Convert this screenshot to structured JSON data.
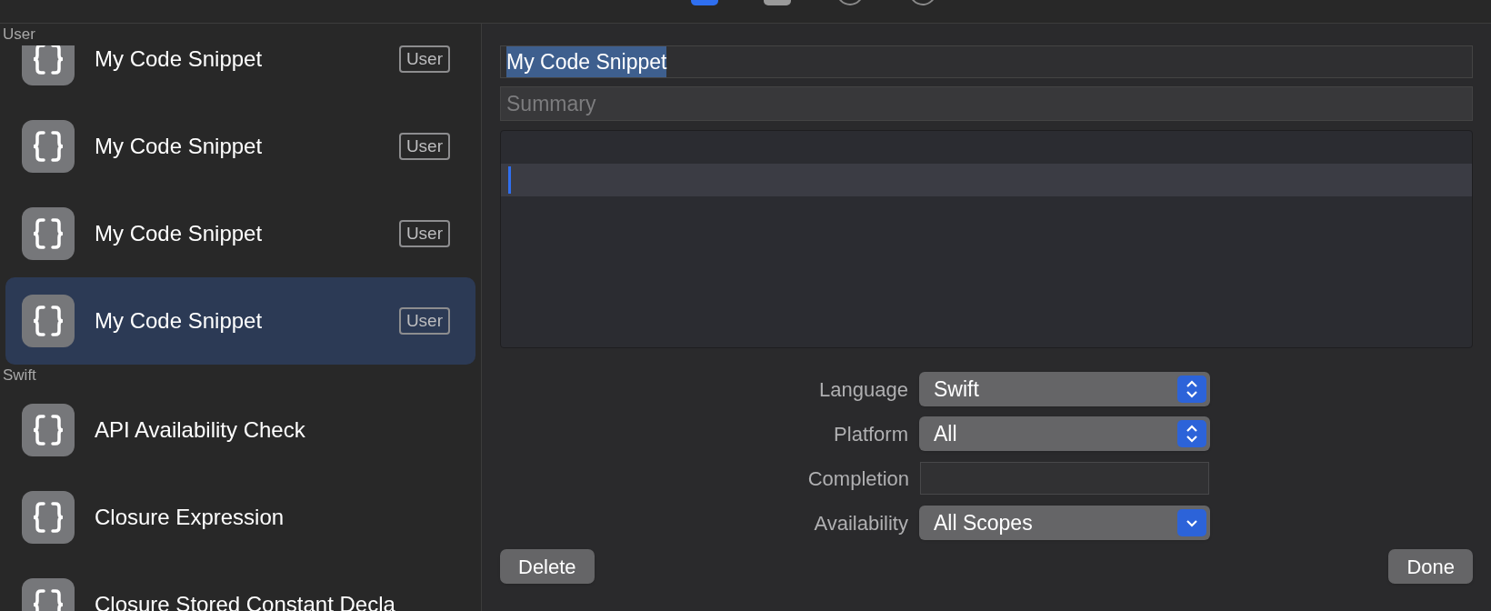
{
  "toolbar": {
    "tabs": [
      {
        "selected": true
      },
      {
        "selected": false
      },
      {
        "selected": false
      },
      {
        "selected": false
      }
    ]
  },
  "sidebar": {
    "sections": [
      {
        "title": "User",
        "items": [
          {
            "title": "My Code Snippet",
            "badge": "User",
            "selected": false
          },
          {
            "title": "My Code Snippet",
            "badge": "User",
            "selected": false
          },
          {
            "title": "My Code Snippet",
            "badge": "User",
            "selected": false
          },
          {
            "title": "My Code Snippet",
            "badge": "User",
            "selected": true
          }
        ]
      },
      {
        "title": "Swift",
        "items": [
          {
            "title": "API Availability Check",
            "selected": false
          },
          {
            "title": "Closure Expression",
            "selected": false
          },
          {
            "title": "Closure Stored Constant Decla",
            "selected": false
          }
        ]
      }
    ]
  },
  "editor": {
    "title": {
      "value": "My Code Snippet",
      "text_selected": true
    },
    "summary": {
      "placeholder": "Summary"
    },
    "code": {
      "current_line_highlighted": true
    },
    "fields": [
      {
        "label": "Language",
        "kind": "stepper",
        "value": "Swift"
      },
      {
        "label": "Platform",
        "kind": "stepper",
        "value": "All"
      },
      {
        "label": "Completion",
        "kind": "text"
      },
      {
        "label": "Availability",
        "kind": "pulldown",
        "value": "All Scopes"
      }
    ],
    "buttons": [
      {
        "label": "Delete"
      },
      {
        "label": "Done"
      }
    ]
  }
}
